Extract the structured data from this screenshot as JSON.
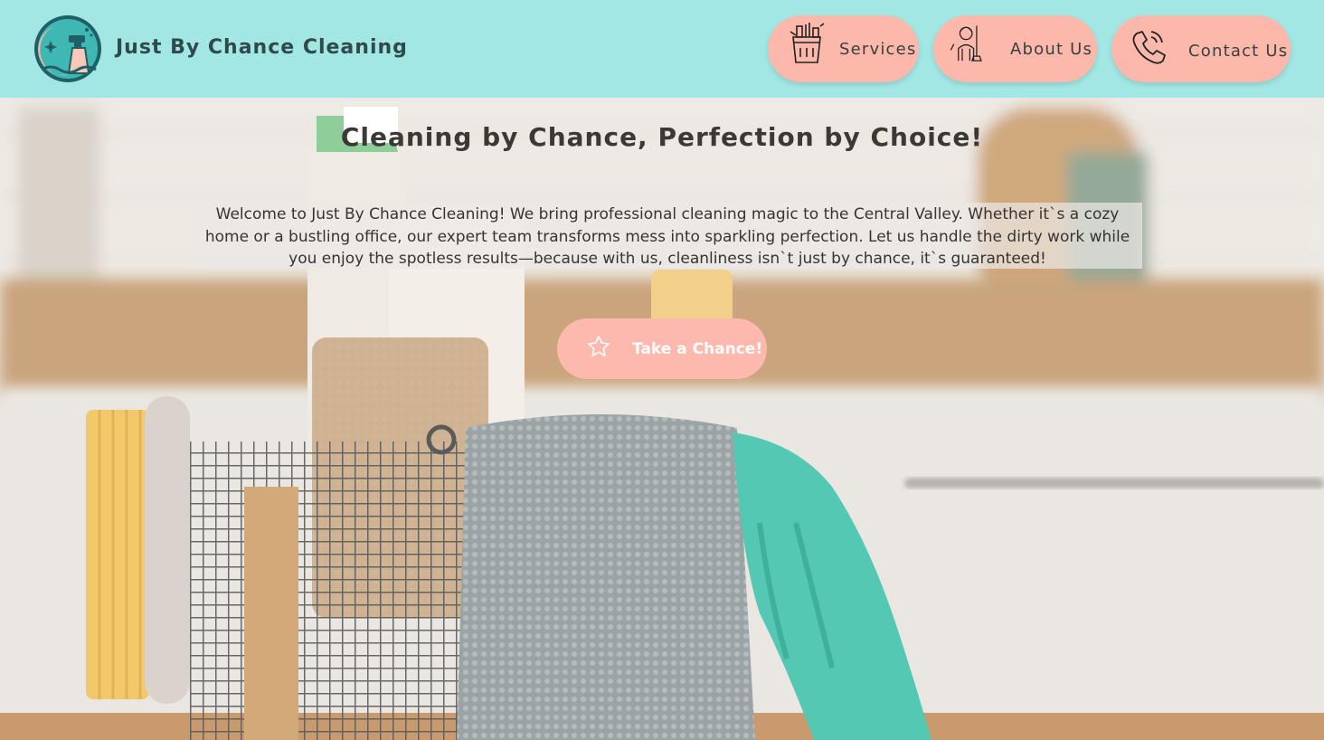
{
  "header": {
    "brand_name": "Just By Chance Cleaning",
    "logo_icon": "spray-bottle-moon-logo",
    "background_color": "#a2e7e4"
  },
  "nav": {
    "items": [
      {
        "label": "Services",
        "icon": "cleaning-bucket-icon"
      },
      {
        "label": "About Us",
        "icon": "cleaner-person-icon"
      },
      {
        "label": "Contact Us",
        "icon": "phone-icon"
      }
    ],
    "button_color": "#fcb8aa"
  },
  "hero": {
    "headline": "Cleaning by Chance, Perfection by Choice!",
    "intro": "Welcome to Just By Chance Cleaning! We bring professional cleaning magic to the Central Valley. Whether it`s a cozy home or a bustling office, our expert team transforms mess into sparkling perfection. Let us handle the dirty work while you enjoy the spotless results—because with us, cleanliness isn`t just by chance, it`s guaranteed!",
    "cta_label": "Take a Chance!",
    "cta_icon": "star-icon",
    "cta_color": "#fdb9ad"
  }
}
